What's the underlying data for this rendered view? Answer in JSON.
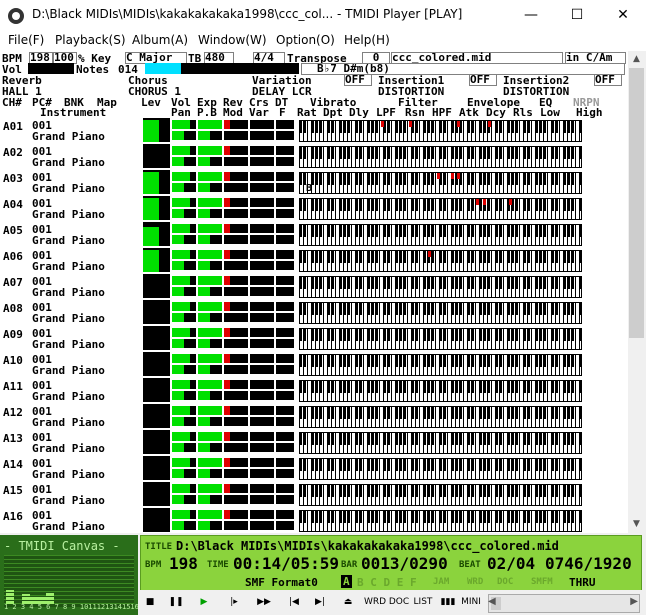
{
  "window": {
    "title": "D:\\Black MIDIs\\MIDIs\\kakakakakaka1998\\ccc_col... - TMIDI Player [PLAY]",
    "minimize": "—",
    "maximize": "☐",
    "close": "✕"
  },
  "menu": [
    "File(F)",
    "Playback(S)",
    "Album(A)",
    "Window(W)",
    "Option(O)",
    "Help(H)"
  ],
  "status": {
    "bpm_label": "BPM",
    "bpm_value": "198",
    "percent": "100",
    "key_label": "% Key",
    "key_value": "C  Major",
    "tb_label": "TB",
    "tb_value": "480",
    "time_sig": "4/4",
    "transpose_label": "Transpose",
    "transpose_value": "0",
    "filename": "ccc_colored.mid",
    "key_short": "in C/Am",
    "vol_label": "Vol",
    "notes_label": "Notes",
    "notes_value": "014",
    "chord": "B♭7 D#m(b8)"
  },
  "effects": {
    "reverb": "Reverb",
    "reverb_type": "HALL 1",
    "chorus": "Chorus",
    "chorus_type": "CHORUS 1",
    "variation": "Variation",
    "variation_state": "OFF",
    "variation_type": "DELAY LCR",
    "insertion1": "Insertion1",
    "insertion1_state": "OFF",
    "insertion1_type": "DISTORTION",
    "insertion2": "Insertion2",
    "insertion2_state": "OFF",
    "insertion2_type": "DISTORTION"
  },
  "headers": {
    "ch": "CH#",
    "pc": "PC#",
    "bnk": "BNK",
    "map": "Map",
    "instrument": "Instrument",
    "lev": "Lev",
    "vol": "Vol",
    "exp": "Exp",
    "rev": "Rev",
    "crs": "Crs",
    "dt": "DT",
    "pan": "Pan",
    "pb": "P.B",
    "mod": "Mod",
    "var": "Var",
    "f": "F",
    "vibrato": "Vibrato",
    "filter": "Filter",
    "envelope": "Envelope",
    "eq": "EQ",
    "nrpn": "NRPN",
    "rat": "Rat",
    "dpt": "Dpt",
    "dly": "Dly",
    "lpf": "LPF",
    "rsn": "Rsn",
    "hpf": "HPF",
    "atk": "Atk",
    "dcy": "Dcy",
    "rls": "Rls",
    "low": "Low",
    "high": "High"
  },
  "channels": [
    {
      "ch": "A01",
      "pc": "001",
      "inst": "Grand Piano",
      "lev": 0.9
    },
    {
      "ch": "A02",
      "pc": "001",
      "inst": "Grand Piano",
      "lev": 0.0
    },
    {
      "ch": "A03",
      "pc": "001",
      "inst": "Grand Piano",
      "lev": 0.9
    },
    {
      "ch": "A04",
      "pc": "001",
      "inst": "Grand Piano",
      "lev": 0.9
    },
    {
      "ch": "A05",
      "pc": "001",
      "inst": "Grand Piano",
      "lev": 0.8
    },
    {
      "ch": "A06",
      "pc": "001",
      "inst": "Grand Piano",
      "lev": 0.9
    },
    {
      "ch": "A07",
      "pc": "001",
      "inst": "Grand Piano",
      "lev": 0.0
    },
    {
      "ch": "A08",
      "pc": "001",
      "inst": "Grand Piano",
      "lev": 0.0
    },
    {
      "ch": "A09",
      "pc": "001",
      "inst": "Grand Piano",
      "lev": 0.0
    },
    {
      "ch": "A10",
      "pc": "001",
      "inst": "Grand Piano",
      "lev": 0.0
    },
    {
      "ch": "A11",
      "pc": "001",
      "inst": "Grand Piano",
      "lev": 0.0
    },
    {
      "ch": "A12",
      "pc": "001",
      "inst": "Grand Piano",
      "lev": 0.0
    },
    {
      "ch": "A13",
      "pc": "001",
      "inst": "Grand Piano",
      "lev": 0.0
    },
    {
      "ch": "A14",
      "pc": "001",
      "inst": "Grand Piano",
      "lev": 0.0
    },
    {
      "ch": "A15",
      "pc": "001",
      "inst": "Grand Piano",
      "lev": 0.0
    },
    {
      "ch": "A16",
      "pc": "001",
      "inst": "Grand Piano",
      "lev": 0.0
    }
  ],
  "a03_marker": "B",
  "canvas": {
    "title": "- TMIDI Canvas -",
    "channel_numbers": "1 2 3 4 5 6 7 8 9 10111213141516"
  },
  "info": {
    "title_label": "TITLE",
    "title_value": "D:\\Black MIDIs\\MIDIs\\kakakakakaka1998\\ccc_colored.mid",
    "bpm_label": "BPM",
    "bpm_value": "198",
    "time_label": "TIME",
    "time_value": "00:14/05:59",
    "bar_label": "BAR",
    "bar_value": "0013/0290",
    "beat_label": "BEAT",
    "beat_value": "02/04",
    "tick_value": "0746/1920",
    "format": "SMF Format0",
    "mode_a": "A",
    "mode_letters": "B C D E F",
    "thru": "THRU",
    "jam": "JAM",
    "wrd": "WRD",
    "doc": "DOC",
    "smfm": "SMFM"
  },
  "toolbar": {
    "wrd": "WRD",
    "doc": "DOC",
    "list": "LIST",
    "mini": "MINI"
  },
  "colors": {
    "green": "#00e000",
    "dark_green": "#006000",
    "red": "#e00000",
    "lcd": "#8bd33d",
    "cyan": "#00e0ff"
  }
}
